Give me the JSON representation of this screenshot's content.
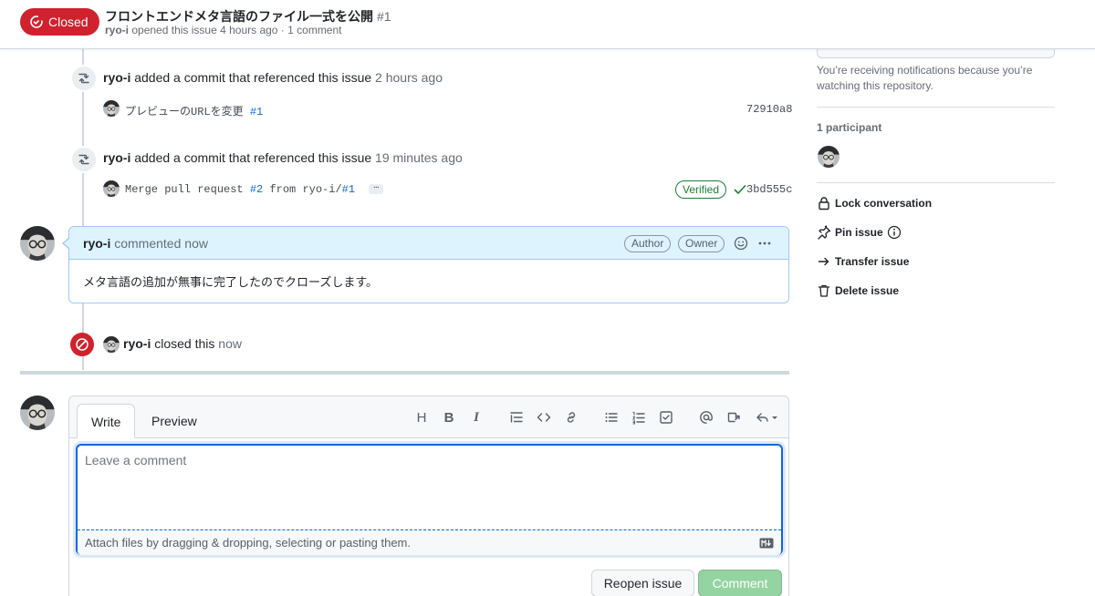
{
  "header": {
    "state_label": "Closed",
    "title": "フロントエンドメタ言語のファイル一式を公開",
    "number": "#1",
    "author": "ryo-i",
    "meta_text": "opened this issue 4 hours ago · 1 comment"
  },
  "timeline": {
    "events": [
      {
        "actor": "ryo-i",
        "action": "added a commit that referenced this issue",
        "time": "2 hours ago",
        "commit_message": "プレビューのURLを変更",
        "commit_ref": "#1",
        "sha": "72910a8"
      },
      {
        "actor": "ryo-i",
        "action": "added a commit that referenced this issue",
        "time": "19 minutes ago",
        "commit_message_prefix": "Merge pull request",
        "commit_pr": "#2",
        "commit_message_mid": "from ryo-i/",
        "commit_ref": "#1",
        "ellipsis": "…",
        "verified_label": "Verified",
        "sha": "3bd555c"
      }
    ],
    "comment": {
      "author": "ryo-i",
      "action": "commented",
      "time": "now",
      "labels": [
        "Author",
        "Owner"
      ],
      "body": "メタ言語の追加が無事に完了したのでクローズします。"
    },
    "closed_event": {
      "actor": "ryo-i",
      "action": "closed this",
      "time": "now"
    }
  },
  "form": {
    "tabs": [
      "Write",
      "Preview"
    ],
    "placeholder": "Leave a comment",
    "attach_text": "Attach files by dragging & dropping, selecting or pasting them.",
    "toolbar": {
      "heading": "H",
      "bold": "B",
      "italic": "I"
    },
    "reopen_label": "Reopen issue",
    "comment_label": "Comment"
  },
  "sidebar": {
    "notification_text": "You’re receiving notifications because you’re watching this repository.",
    "participants_heading": "1 participant",
    "actions": [
      {
        "label": "Lock conversation",
        "icon": "lock-icon"
      },
      {
        "label": "Pin issue",
        "icon": "pin-icon"
      },
      {
        "label": "Transfer issue",
        "icon": "arrow-right-icon"
      },
      {
        "label": "Delete issue",
        "icon": "trash-icon"
      }
    ]
  },
  "colors": {
    "closed_red": "#cf222e",
    "link_blue": "#0969da",
    "verified_green": "#1a7f37",
    "comment_button_disabled": "#94d3a2",
    "comment_header_bg": "#ddf4ff"
  }
}
